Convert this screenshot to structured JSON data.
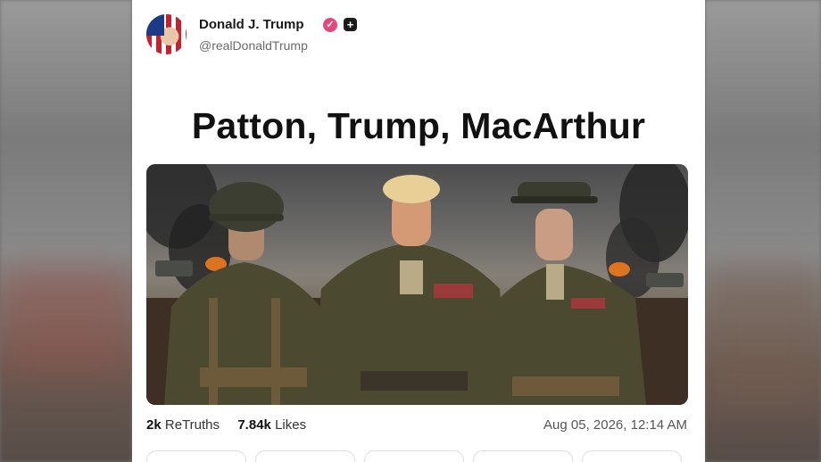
{
  "post": {
    "author_name": "Donald J. Trump",
    "handle": "@realDonaldTrump",
    "title": "Patton, Trump, MacArthur",
    "image_alt": "three generals",
    "retruths_count": "2k",
    "retruths_label": "ReTruths",
    "likes_count": "7.84k",
    "likes_label": "Likes",
    "timestamp": "Aug 05, 2026, 12:14 AM"
  },
  "icons": {
    "verified": "verified-badge-icon",
    "plus": "plus-badge-icon"
  },
  "colors": {
    "verified_badge": "#e6477a",
    "card_background": "#ffffff"
  }
}
